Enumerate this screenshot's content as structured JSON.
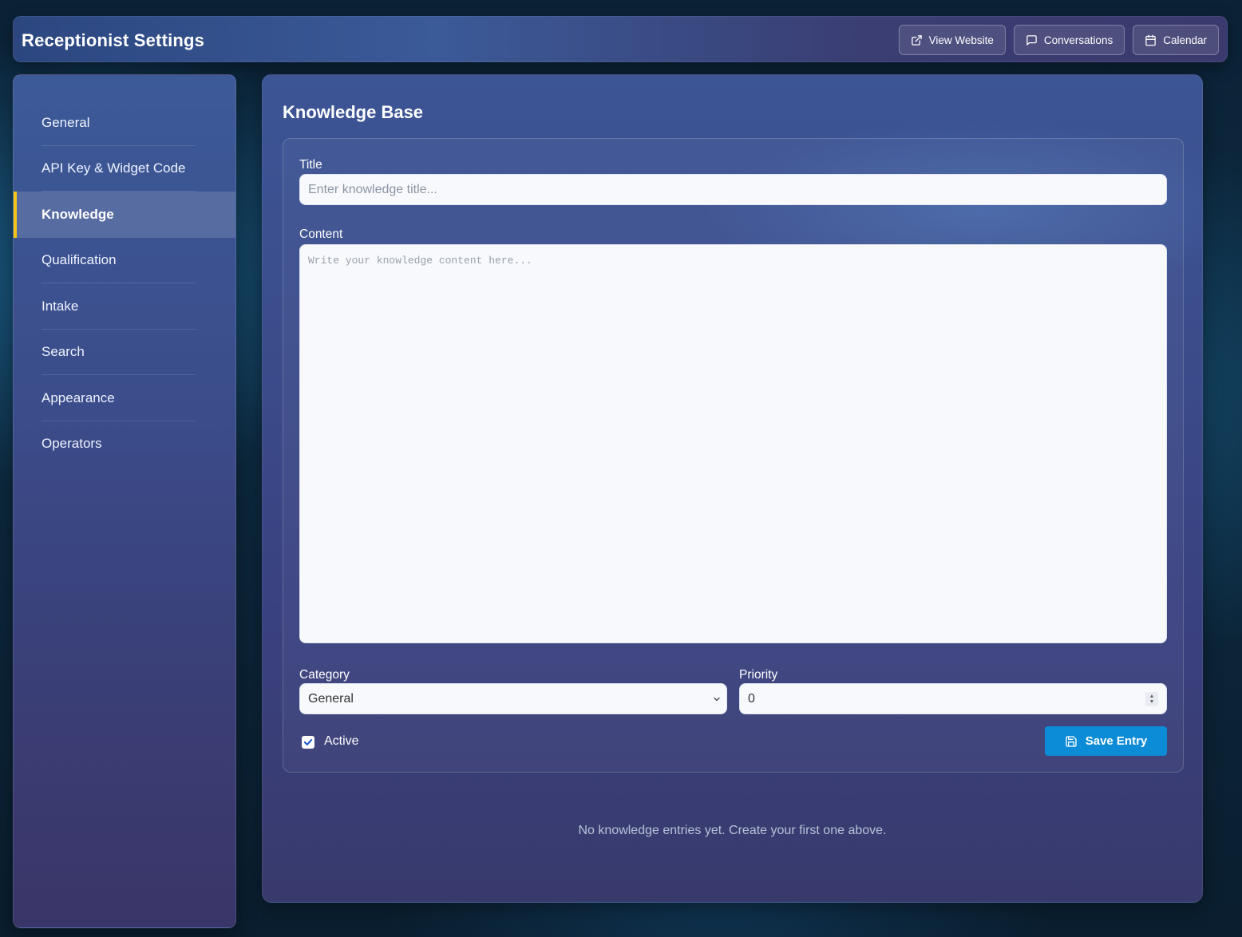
{
  "header": {
    "title": "Receptionist Settings",
    "actions": [
      {
        "label": "View Website",
        "icon": "external-link-icon"
      },
      {
        "label": "Conversations",
        "icon": "chat-icon"
      },
      {
        "label": "Calendar",
        "icon": "calendar-icon"
      }
    ]
  },
  "sidebar": {
    "items": [
      {
        "label": "General"
      },
      {
        "label": "API Key & Widget Code"
      },
      {
        "label": "Knowledge",
        "active": true
      },
      {
        "label": "Qualification"
      },
      {
        "label": "Intake"
      },
      {
        "label": "Search"
      },
      {
        "label": "Appearance"
      },
      {
        "label": "Operators"
      }
    ],
    "active_color": "#f5c518"
  },
  "main": {
    "title": "Knowledge Base",
    "form": {
      "title_label": "Title",
      "title_placeholder": "Enter knowledge title...",
      "content_label": "Content",
      "content_placeholder": "Write your knowledge content here...",
      "category_label": "Category",
      "category_value": "General",
      "priority_label": "Priority",
      "priority_value": "0",
      "active_label": "Active",
      "active_checked": true,
      "save_label": "Save Entry"
    },
    "empty_message": "No knowledge entries yet. Create your first one above."
  },
  "colors": {
    "accent": "#0c8bd6",
    "active_indicator": "#f5c518"
  }
}
